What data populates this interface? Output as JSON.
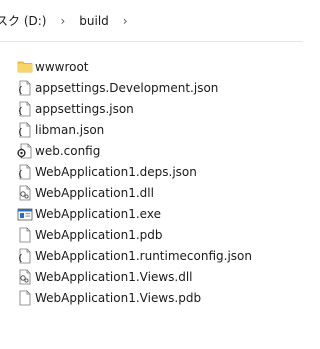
{
  "breadcrumb": {
    "drive": "スク (D:)",
    "folder": "build",
    "separator": "›"
  },
  "files": [
    {
      "name": "wwwroot",
      "icon": "folder-icon"
    },
    {
      "name": "appsettings.Development.json",
      "icon": "json-file-icon"
    },
    {
      "name": "appsettings.json",
      "icon": "json-file-icon"
    },
    {
      "name": "libman.json",
      "icon": "json-file-icon"
    },
    {
      "name": "web.config",
      "icon": "config-file-icon"
    },
    {
      "name": "WebApplication1.deps.json",
      "icon": "json-file-icon"
    },
    {
      "name": "WebApplication1.dll",
      "icon": "dll-file-icon"
    },
    {
      "name": "WebApplication1.exe",
      "icon": "exe-file-icon"
    },
    {
      "name": "WebApplication1.pdb",
      "icon": "blank-file-icon"
    },
    {
      "name": "WebApplication1.runtimeconfig.json",
      "icon": "json-file-icon"
    },
    {
      "name": "WebApplication1.Views.dll",
      "icon": "dll-file-icon"
    },
    {
      "name": "WebApplication1.Views.pdb",
      "icon": "blank-file-icon"
    }
  ],
  "colors": {
    "folder": "#f4c74a",
    "exe_accent": "#1f6fd1"
  }
}
